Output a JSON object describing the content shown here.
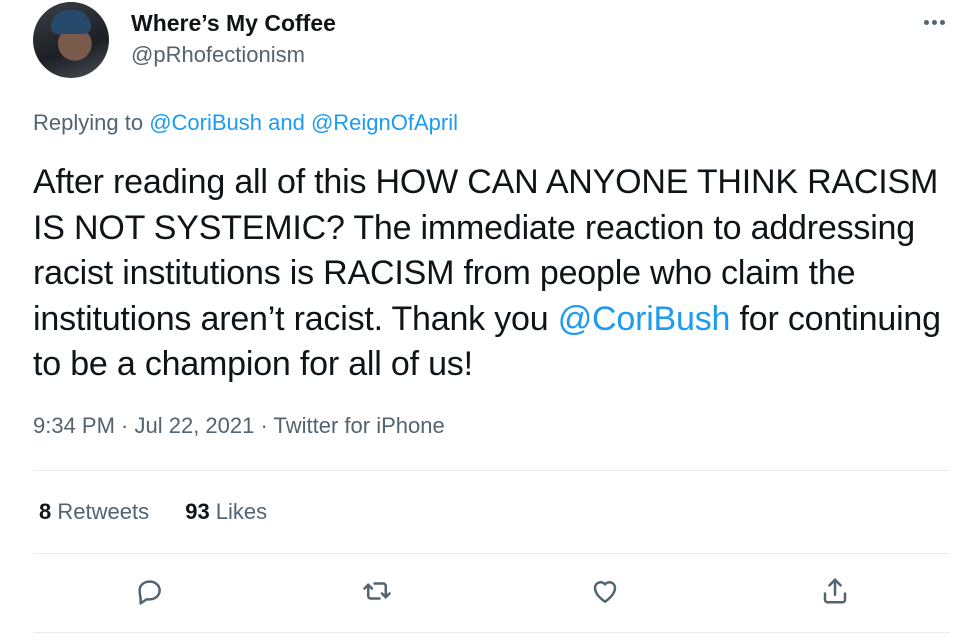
{
  "author": {
    "name": "Where’s My Coffee",
    "handle": "@pRhofectionism"
  },
  "reply": {
    "prefix": "Replying to ",
    "mention1": "@CoriBush",
    "joiner": " and ",
    "mention2": "@ReignOfApril"
  },
  "tweet": {
    "text_before": "After reading all of this HOW CAN ANYONE THINK RACISM IS NOT SYSTEMIC? The immediate reaction to addressing racist institutions is RACISM from people who claim the institutions aren’t racist. Thank you ",
    "mention": "@CoriBush",
    "text_after": " for continuing to be a champion for all of us!"
  },
  "meta": {
    "time": "9:34 PM",
    "sep1": " · ",
    "date": "Jul 22, 2021",
    "sep2": " · ",
    "source": "Twitter for iPhone"
  },
  "stats": {
    "retweets_count": "8",
    "retweets_label": " Retweets",
    "likes_count": "93",
    "likes_label": " Likes"
  },
  "icons": [
    "more-icon",
    "reply-icon",
    "retweet-icon",
    "like-icon",
    "share-icon"
  ],
  "colors": {
    "link": "#1d9bf0",
    "secondary": "#536471",
    "text": "#0f1419",
    "divider": "#e6ecf0"
  }
}
